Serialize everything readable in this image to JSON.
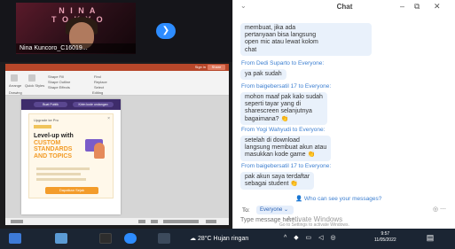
{
  "video": {
    "brand_line1": "N I N A",
    "brand_line2": "T O K Y O",
    "participant_name": "Nina Kuncoro_C16019...",
    "next_icon": "chevron-right-icon"
  },
  "ppt": {
    "sign_in": "Sign in",
    "share": "Share",
    "ribbon_labels": [
      "Arrange",
      "Quick Styles",
      "Shape Fill",
      "Shape Outline",
      "Shape Effects",
      "Find",
      "Replace",
      "Select",
      "Drawing",
      "Editing"
    ],
    "slide": {
      "tab1": "Buat Publik",
      "tab2": "Kirim kode undangan",
      "upgrade": "Upgrade ke Pro",
      "headline_a": "Level-up with ",
      "headline_b": "CUSTOM STANDARDS AND TOPICS",
      "cta": "Dapatkan Sejak"
    }
  },
  "chat": {
    "title": "Chat",
    "first_bubble": "membuat, jika ada\npertanyaan bisa langsung\nopen mic atau lewat kolom\nchat",
    "messages": [
      {
        "from": "From Dedi Suparto to Everyone:",
        "text": "ya pak sudah"
      },
      {
        "from": "From baigebersatil 17 to Everyone:",
        "text": "mohon maaf pak kalo sudah\nseperti tayar  yang di\nsharescreen selanjutnya\nbagaimana?"
      },
      {
        "from": "From Yogi Wahyudi to Everyone:",
        "text": "setelah di download\nlangsung membuat akun atau\nmasukkan kode game"
      },
      {
        "from": "From baigebersatil 17 to Everyone:",
        "text": "pak akun saya terdaftar\nsebagai student"
      }
    ],
    "who_can_see": "Who can see your messages?",
    "to_label": "To:",
    "to_value": "Everyone",
    "input_placeholder": "Type message here...",
    "watermark_title": "Activate Windows",
    "watermark_sub": "Go to Settings to activate Windows."
  },
  "taskbar": {
    "weather": "28°C  Hujan ringan",
    "tray": "^ ◆ ▭ ◁ ◎",
    "time": "9:57",
    "date": "11/05/2022"
  },
  "colors": {
    "accent": "#2d8cff",
    "chat_from": "#3c7fd1",
    "bubble": "#e9f1fb",
    "taskbar": "#1b2533"
  }
}
